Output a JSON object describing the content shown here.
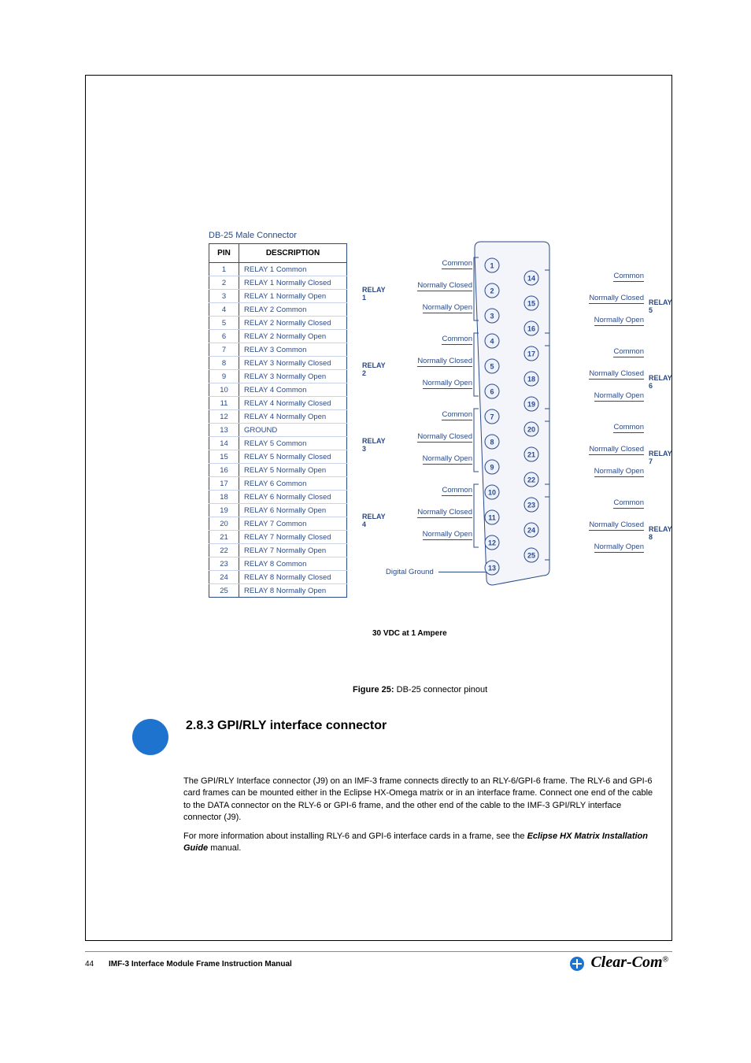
{
  "figure": {
    "connector_title": "DB-25 Male Connector",
    "table_headers": {
      "pin": "PIN",
      "desc": "DESCRIPTION"
    },
    "rows": [
      {
        "pin": "1",
        "desc": "RELAY 1 Common"
      },
      {
        "pin": "2",
        "desc": "RELAY 1 Normally Closed"
      },
      {
        "pin": "3",
        "desc": "RELAY 1 Normally Open"
      },
      {
        "pin": "4",
        "desc": "RELAY 2 Common"
      },
      {
        "pin": "5",
        "desc": "RELAY 2 Normally Closed"
      },
      {
        "pin": "6",
        "desc": "RELAY 2 Normally Open"
      },
      {
        "pin": "7",
        "desc": "RELAY 3 Common"
      },
      {
        "pin": "8",
        "desc": "RELAY 3 Normally Closed"
      },
      {
        "pin": "9",
        "desc": "RELAY 3 Normally Open"
      },
      {
        "pin": "10",
        "desc": "RELAY 4 Common"
      },
      {
        "pin": "11",
        "desc": "RELAY 4 Normally Closed"
      },
      {
        "pin": "12",
        "desc": "RELAY 4 Normally Open"
      },
      {
        "pin": "13",
        "desc": "GROUND"
      },
      {
        "pin": "14",
        "desc": "RELAY 5 Common"
      },
      {
        "pin": "15",
        "desc": "RELAY 5 Normally Closed"
      },
      {
        "pin": "16",
        "desc": "RELAY 5 Normally Open"
      },
      {
        "pin": "17",
        "desc": "RELAY 6 Common"
      },
      {
        "pin": "18",
        "desc": "RELAY 6 Normally Closed"
      },
      {
        "pin": "19",
        "desc": "RELAY 6 Normally Open"
      },
      {
        "pin": "20",
        "desc": "RELAY 7 Common"
      },
      {
        "pin": "21",
        "desc": "RELAY 7 Normally Closed"
      },
      {
        "pin": "22",
        "desc": "RELAY 7 Normally Open"
      },
      {
        "pin": "23",
        "desc": "RELAY 8 Common"
      },
      {
        "pin": "24",
        "desc": "RELAY 8 Normally Closed"
      },
      {
        "pin": "25",
        "desc": "RELAY 8 Normally Open"
      }
    ],
    "footer_note": "30 VDC at 1 Ampere",
    "caption_strong": "Figure 25: ",
    "caption_text": "DB-25 connector pinout",
    "diagram": {
      "left_relays": [
        "RELAY 1",
        "RELAY 2",
        "RELAY 3",
        "RELAY 4"
      ],
      "right_relays": [
        "RELAY 5",
        "RELAY 6",
        "RELAY 7",
        "RELAY 8"
      ],
      "contact_labels": {
        "common": "Common",
        "nc": "Normally Closed",
        "no": "Normally Open"
      },
      "digital_ground": "Digital Ground",
      "pins_left": [
        "1",
        "2",
        "3",
        "4",
        "5",
        "6",
        "7",
        "8",
        "9",
        "10",
        "11",
        "12",
        "13"
      ],
      "pins_right": [
        "14",
        "15",
        "16",
        "17",
        "18",
        "19",
        "20",
        "21",
        "22",
        "23",
        "24",
        "25"
      ]
    }
  },
  "section": {
    "heading": "2.8.3 GPI/RLY interface connector"
  },
  "body": {
    "p1": "The GPI/RLY Interface connector (J9) on an IMF-3 frame connects directly to an RLY-6/GPI-6 frame. The RLY-6 and GPI-6 card frames can be mounted either in the Eclipse HX-Omega matrix or in an interface frame. Connect one end of the cable to the DATA connector on the RLY-6 or GPI-6 frame, and the other end of the cable to the IMF-3 GPI/RLY interface connector (J9).",
    "p2_a": "For more information about installing RLY-6 and GPI-6 interface cards in a frame, see the ",
    "p2_b": " manual.",
    "doc_ref": "Eclipse HX Matrix Installation Guide"
  },
  "footer": {
    "page_number": "44",
    "doc_title": "IMF-3 Interface Module Frame Instruction Manual",
    "brand": "Clear-Com",
    "trademark": "®"
  }
}
